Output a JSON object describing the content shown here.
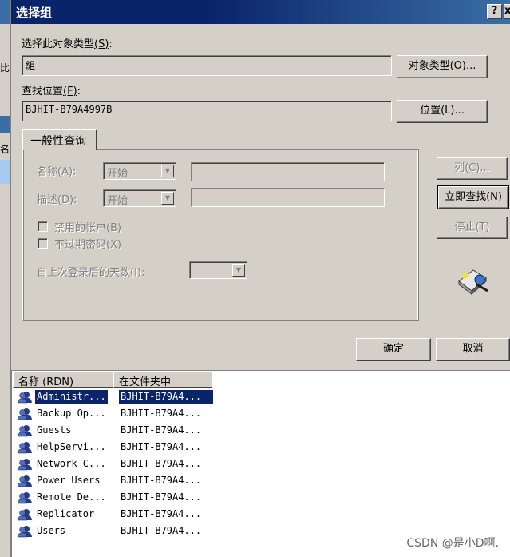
{
  "dialog": {
    "title": "选择组",
    "help_btn": "?",
    "close_btn": "x"
  },
  "object_type": {
    "label": "选择此对象类型",
    "accel": "(S)",
    "suffix": ":",
    "value": "組",
    "button": "对象类型(O)..."
  },
  "location": {
    "label": "查找位置",
    "accel": "(F)",
    "suffix": ":",
    "value": "BJHIT-B79A4997B",
    "button": "位置(L)..."
  },
  "query_tab": {
    "label": "一般性查询"
  },
  "query": {
    "name_label": "名称(A):",
    "name_mode": "开始",
    "desc_label": "描述(D):",
    "desc_mode": "开始",
    "disabled_accounts": "禁用的帐户(B)",
    "non_expiring_pw": "不过期密码(X)",
    "days_since_login": "自上次登录后的天数(I):"
  },
  "side_buttons": {
    "columns": "列(C)...",
    "find_now": "立即查找(N)",
    "stop": "停止(T)"
  },
  "footer": {
    "ok": "确定",
    "cancel": "取消"
  },
  "results": {
    "columns": [
      "名称 (RDN)",
      "在文件夹中"
    ],
    "rows": [
      {
        "name": "Administr...",
        "folder": "BJHIT-B79A4..."
      },
      {
        "name": "Backup Op...",
        "folder": "BJHIT-B79A4..."
      },
      {
        "name": "Guests",
        "folder": "BJHIT-B79A4..."
      },
      {
        "name": "HelpServi...",
        "folder": "BJHIT-B79A4..."
      },
      {
        "name": "Network C...",
        "folder": "BJHIT-B79A4..."
      },
      {
        "name": "Power Users",
        "folder": "BJHIT-B79A4..."
      },
      {
        "name": "Remote De...",
        "folder": "BJHIT-B79A4..."
      },
      {
        "name": "Replicator",
        "folder": "BJHIT-B79A4..."
      },
      {
        "name": "Users",
        "folder": "BJHIT-B79A4..."
      }
    ],
    "selected_index": 0
  },
  "background": {
    "left_chars": [
      "比",
      "名"
    ]
  },
  "watermark": "CSDN @是小D啊."
}
